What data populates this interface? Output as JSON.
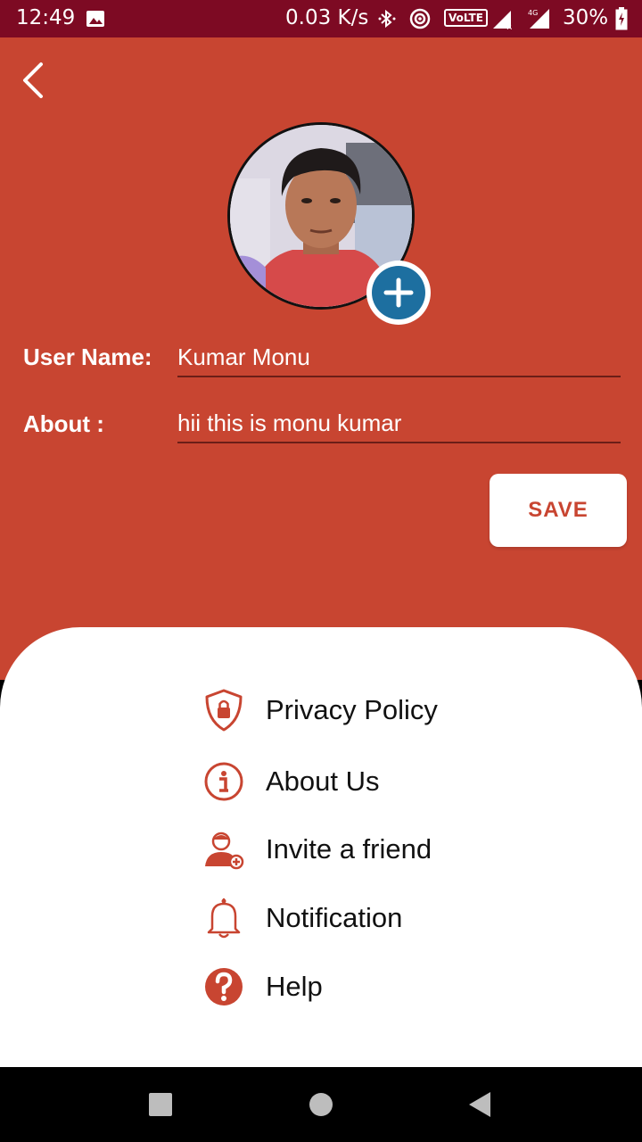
{
  "status_bar": {
    "time": "12:49",
    "network_speed": "0.03 K/s",
    "volte": "VoLTE",
    "battery": "30%",
    "icons": [
      "image-icon",
      "bluetooth-icon",
      "hotspot-icon",
      "signal-icon",
      "signal-4g-icon",
      "battery-charging-icon"
    ]
  },
  "header": {
    "background_color": "#c84531",
    "back_icon": "chevron-left-icon",
    "add_photo_icon": "plus-icon"
  },
  "form": {
    "username_label": "User Name:",
    "username_value": "Kumar Monu",
    "about_label": "About :",
    "about_value": "hii this is monu kumar",
    "save_label": "SAVE"
  },
  "menu": {
    "items": [
      {
        "label": "Privacy Policy",
        "icon": "shield-lock-icon"
      },
      {
        "label": "About Us",
        "icon": "info-icon"
      },
      {
        "label": "Invite a friend",
        "icon": "add-user-icon"
      },
      {
        "label": "Notification",
        "icon": "bell-icon"
      },
      {
        "label": "Help",
        "icon": "help-icon"
      }
    ],
    "icon_color": "#c84531"
  },
  "nav_bar": {
    "buttons": [
      "recents-square-icon",
      "home-circle-icon",
      "back-triangle-icon"
    ]
  }
}
